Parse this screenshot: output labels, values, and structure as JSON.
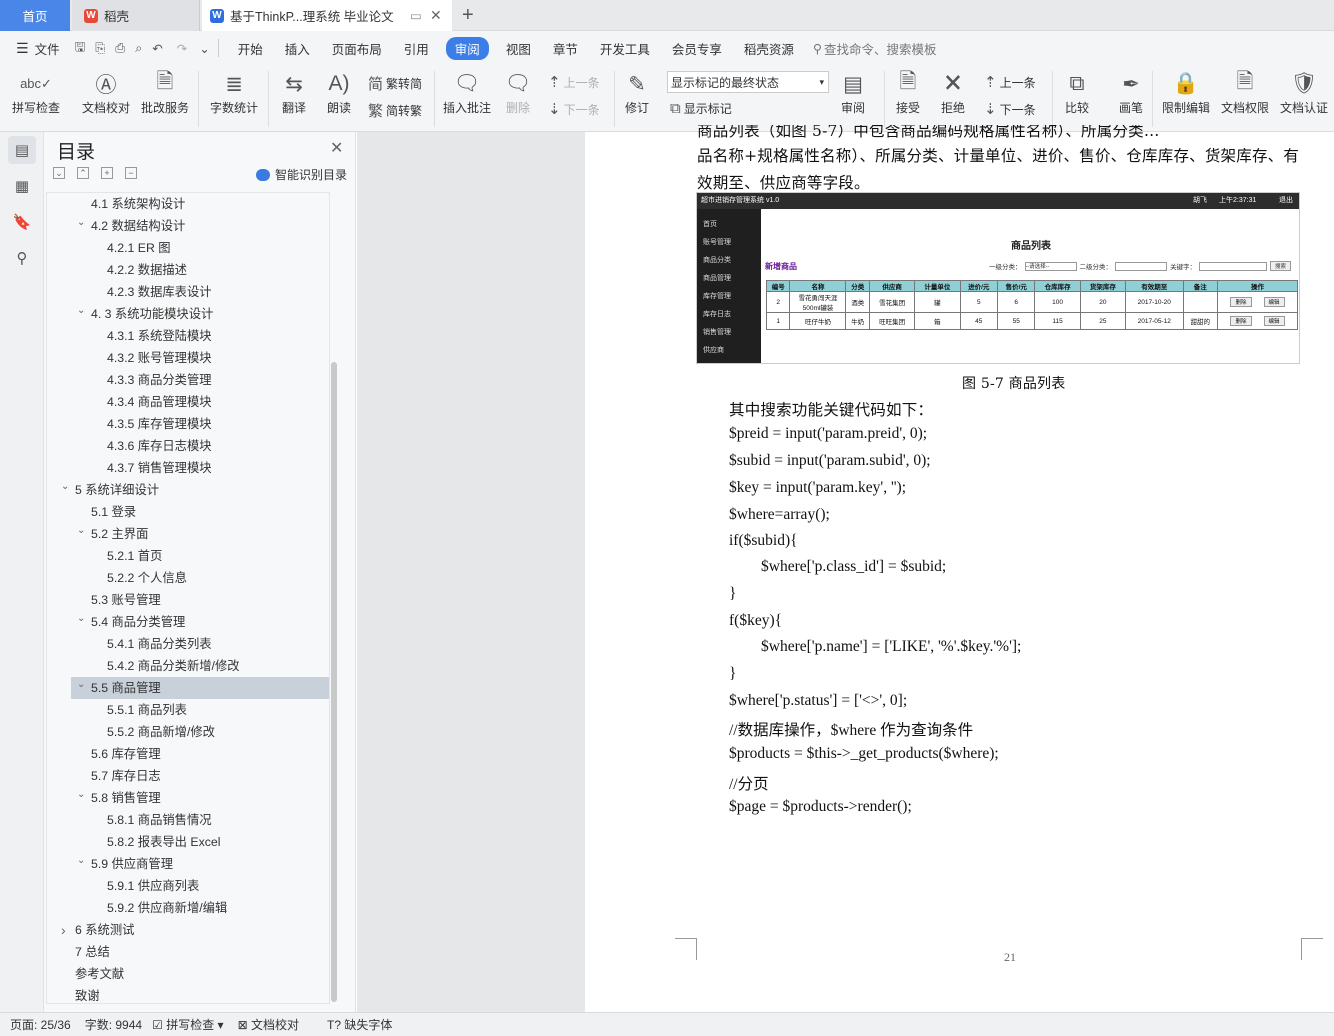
{
  "tabs": {
    "home": "首页",
    "daoke": "稻壳",
    "doc": "基于ThinkP...理系统 毕业论文",
    "add": "+"
  },
  "menu": {
    "file": "文件",
    "items": [
      "开始",
      "插入",
      "页面布局",
      "引用",
      "审阅",
      "视图",
      "章节",
      "开发工具",
      "会员专享",
      "稻壳资源"
    ],
    "search_placeholder": "查找命令、搜索模板"
  },
  "ribbon": {
    "spell": "拼写检查",
    "proof": "文档校对",
    "batch": "批改服务",
    "wordcount": "字数统计",
    "translate": "翻译",
    "read": "朗读",
    "trad2simp": "繁转简",
    "simp2trad": "简转繁",
    "insert_comment": "插入批注",
    "delete": "删除",
    "prev": "上一条",
    "next": "下一条",
    "revise": "修订",
    "markup_state": "显示标记的最终状态",
    "show_markup": "显示标记",
    "review": "审阅",
    "accept": "接受",
    "reject": "拒绝",
    "prev2": "上一条",
    "next2": "下一条",
    "compare": "比较",
    "ink": "画笔",
    "restrict": "限制编辑",
    "perm": "文档权限",
    "cert": "文档认证"
  },
  "toc": {
    "title": "目录",
    "smart": "智能识别目录",
    "items": [
      {
        "t": "4.1  系统架构设计",
        "lv": 2
      },
      {
        "t": "4.2  数据结构设计",
        "lv": 2,
        "arrow": "v"
      },
      {
        "t": "4.2.1 ER 图",
        "lv": 3
      },
      {
        "t": "4.2.2  数据描述",
        "lv": 3
      },
      {
        "t": "4.2.3  数据库表设计",
        "lv": 3
      },
      {
        "t": "4. 3  系统功能模块设计",
        "lv": 2,
        "arrow": "v"
      },
      {
        "t": "4.3.1  系统登陆模块",
        "lv": 3
      },
      {
        "t": "4.3.2  账号管理模块",
        "lv": 3
      },
      {
        "t": "4.3.3  商品分类管理",
        "lv": 3
      },
      {
        "t": "4.3.4  商品管理模块",
        "lv": 3
      },
      {
        "t": "4.3.5  库存管理模块",
        "lv": 3
      },
      {
        "t": "4.3.6  库存日志模块",
        "lv": 3
      },
      {
        "t": "4.3.7  销售管理模块",
        "lv": 3
      },
      {
        "t": "5  系统详细设计",
        "lv": 1,
        "arrow": "v"
      },
      {
        "t": "5.1  登录",
        "lv": 2
      },
      {
        "t": "5.2  主界面",
        "lv": 2,
        "arrow": "v"
      },
      {
        "t": "5.2.1  首页",
        "lv": 3
      },
      {
        "t": "5.2.2  个人信息",
        "lv": 3
      },
      {
        "t": "5.3  账号管理",
        "lv": 2
      },
      {
        "t": "5.4  商品分类管理",
        "lv": 2,
        "arrow": "v"
      },
      {
        "t": "5.4.1  商品分类列表",
        "lv": 3
      },
      {
        "t": "5.4.2  商品分类新增/修改",
        "lv": 3
      },
      {
        "t": "5.5  商品管理",
        "lv": 2,
        "arrow": "v",
        "sel": true
      },
      {
        "t": "5.5.1 商品列表",
        "lv": 3
      },
      {
        "t": "5.5.2 商品新增/修改",
        "lv": 3
      },
      {
        "t": "5.6  库存管理",
        "lv": 2
      },
      {
        "t": "5.7  库存日志",
        "lv": 2
      },
      {
        "t": "5.8  销售管理",
        "lv": 2,
        "arrow": "v"
      },
      {
        "t": "5.8.1  商品销售情况",
        "lv": 3
      },
      {
        "t": "5.8.2  报表导出 Excel",
        "lv": 3
      },
      {
        "t": "5.9  供应商管理",
        "lv": 2,
        "arrow": "v"
      },
      {
        "t": "5.9.1  供应商列表",
        "lv": 3
      },
      {
        "t": "5.9.2  供应商新增/编辑",
        "lv": 3
      },
      {
        "t": "6  系统测试",
        "lv": 1,
        "arrow": ">"
      },
      {
        "t": "7  总结",
        "lv": 1
      },
      {
        "t": "参考文献",
        "lv": 1
      },
      {
        "t": "致谢",
        "lv": 1
      }
    ]
  },
  "doc": {
    "para_top": "商品列表（如图 5-7）中包含商品编码规格属性名称）、所属分类…",
    "para1": "品名称+规格属性名称）、所属分类、计量单位、进价、售价、仓库库存、货架库存、有",
    "para2": "效期至、供应商等字段。",
    "caption": "图 5-7  商品列表",
    "intro": "其中搜索功能关键代码如下：",
    "code": [
      "$preid = input('param.preid', 0);",
      "$subid = input('param.subid', 0);",
      "$key = input('param.key', '');",
      "$where=array();",
      "if($subid){",
      "$where['p.class_id'] = $subid;",
      "}",
      "f($key){",
      "$where['p.name'] = ['LIKE', '%'.$key.'%'];",
      "}",
      "$where['p.status'] = ['<>', 0];",
      "//数据库操作，$where 作为查询条件",
      "$products = $this->_get_products($where);",
      "//分页",
      "$page = $products->render();"
    ],
    "page_no": "21"
  },
  "shot": {
    "sys": "超市进销存管理系统  v1.0",
    "user": "胡飞",
    "time": "上午2:37:31",
    "logout": "退出",
    "nav": [
      "首页",
      "账号管理",
      "商品分类",
      "商品管理",
      "库存管理",
      "库存日志",
      "销售管理",
      "供应商"
    ],
    "heading": "商品列表",
    "add": "新增商品",
    "filter1": "一级分类：",
    "filter1_val": "--请选择--",
    "filter2": "二级分类：",
    "kw": "关键字：",
    "search": "搜索",
    "cols": [
      "编号",
      "名称",
      "分类",
      "供应商",
      "计量单位",
      "进价/元",
      "售价/元",
      "仓库库存",
      "货架库存",
      "有效期至",
      "备注",
      "操作"
    ],
    "rows": [
      [
        "2",
        "雪花勇闯天涯500ml罐装",
        "酒类",
        "雪花集团",
        "罐",
        "5",
        "6",
        "100",
        "20",
        "2017-10-20",
        ""
      ],
      [
        "1",
        "旺仔牛奶",
        "牛奶",
        "旺旺集团",
        "箱",
        "45",
        "55",
        "115",
        "25",
        "2017-05-12",
        "甜甜的"
      ]
    ],
    "del": "删除",
    "edit": "编辑"
  },
  "status": {
    "page": "页面: 25/36",
    "words": "字数: 9944",
    "spell": "拼写检查",
    "proof": "文档校对",
    "font": "缺失字体"
  }
}
